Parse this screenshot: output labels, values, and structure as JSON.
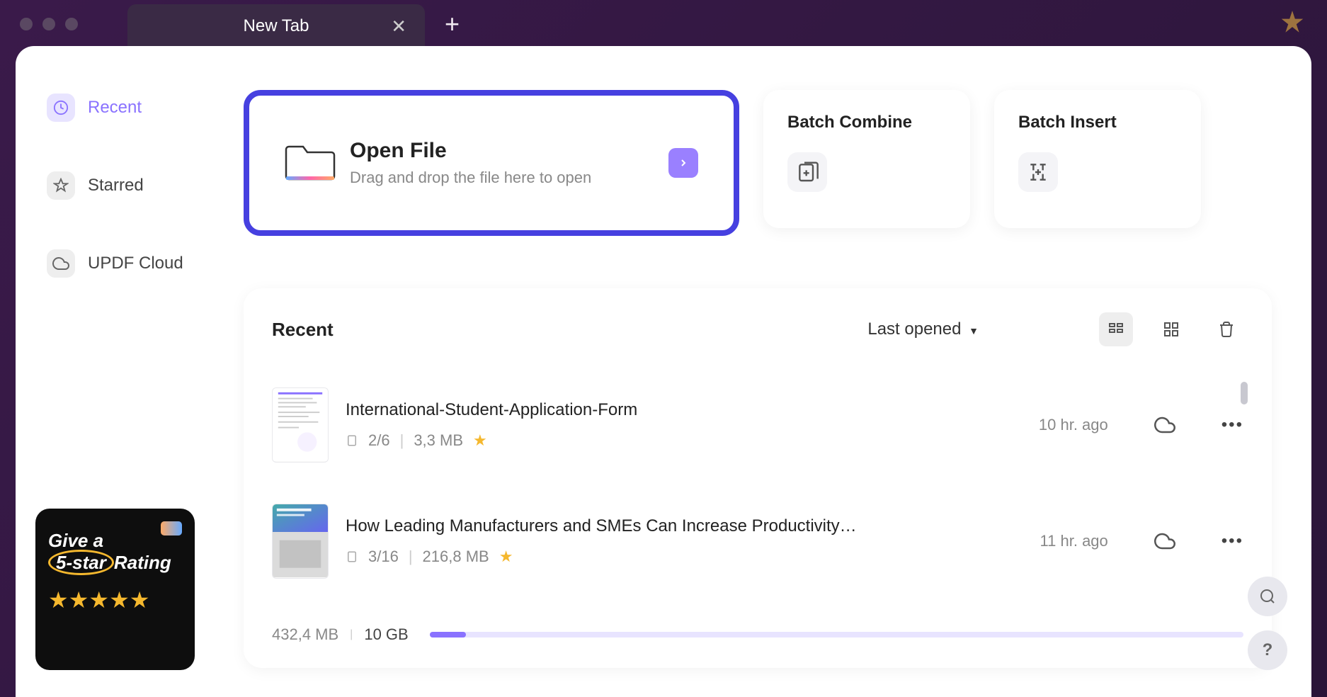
{
  "titlebar": {
    "tab_label": "New Tab"
  },
  "sidebar": {
    "items": [
      {
        "label": "Recent",
        "icon": "clock"
      },
      {
        "label": "Starred",
        "icon": "star"
      },
      {
        "label": "UPDF Cloud",
        "icon": "cloud"
      }
    ]
  },
  "open_file": {
    "title": "Open File",
    "subtitle": "Drag and drop the file here to open"
  },
  "batch_cards": [
    {
      "title": "Batch Combine"
    },
    {
      "title": "Batch Insert"
    }
  ],
  "recent": {
    "title": "Recent",
    "sort": "Last opened",
    "files": [
      {
        "name": "International-Student-Application-Form",
        "pages": "2/6",
        "size": "3,3 MB",
        "time": "10 hr. ago",
        "starred": true
      },
      {
        "name": "How Leading Manufacturers and SMEs Can Increase Productivity…",
        "pages": "3/16",
        "size": "216,8 MB",
        "time": "11 hr. ago",
        "starred": true
      }
    ]
  },
  "storage": {
    "used": "432,4 MB",
    "total": "10 GB",
    "percent": 4.3
  },
  "promo": {
    "line1": "Give a",
    "line2a": "5-star",
    "line2b": "Rating"
  }
}
